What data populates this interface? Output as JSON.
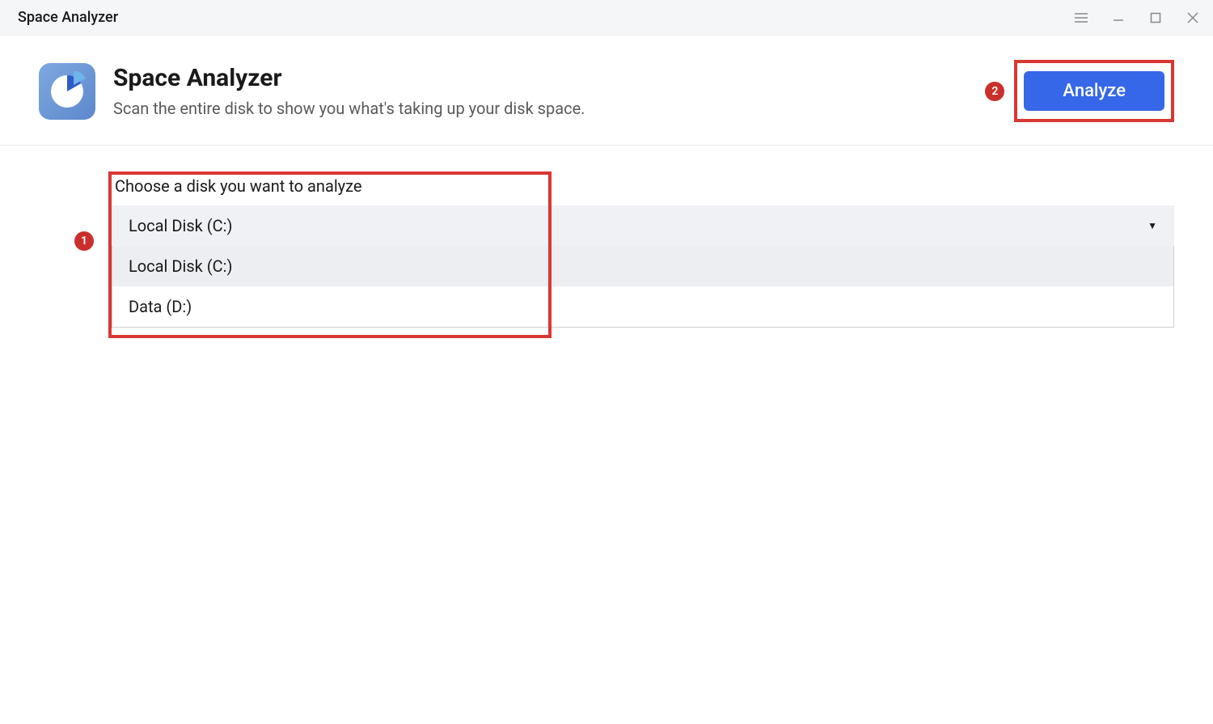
{
  "window": {
    "title": "Space Analyzer"
  },
  "header": {
    "title": "Space Analyzer",
    "subtitle": "Scan the entire disk to show you what's taking up your disk space.",
    "analyze_button_label": "Analyze"
  },
  "callouts": {
    "badge1": "1",
    "badge2": "2"
  },
  "disk_selector": {
    "label": "Choose a disk you want to analyze",
    "selected": "Local Disk (C:)",
    "options": [
      "Local Disk (C:)",
      "Data (D:)"
    ]
  },
  "colors": {
    "accent": "#3667e8",
    "callout": "#d93832"
  }
}
